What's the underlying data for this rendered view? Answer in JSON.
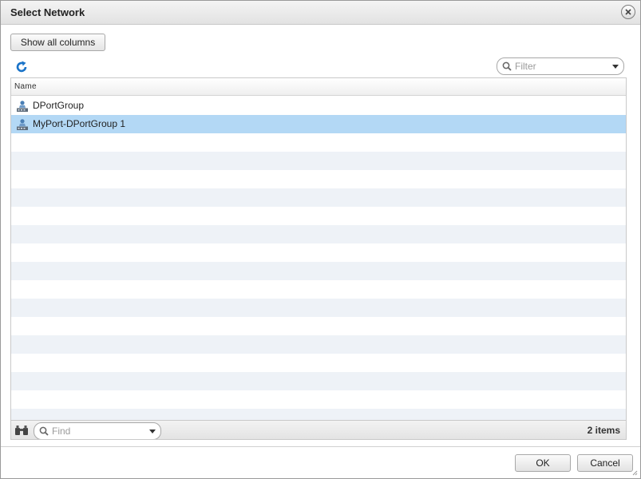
{
  "dialog": {
    "title": "Select Network",
    "close_icon": "close-icon"
  },
  "toolbar": {
    "show_columns_label": "Show all columns",
    "refresh_icon": "refresh-icon",
    "filter_placeholder": "Filter"
  },
  "grid": {
    "columns": [
      "Name"
    ],
    "rows": [
      {
        "name": "DPortGroup",
        "icon": "port-group-icon",
        "selected": false
      },
      {
        "name": "MyPort-DPortGroup 1",
        "icon": "port-group-icon",
        "selected": true
      }
    ],
    "find_placeholder": "Find",
    "item_count": "2 items"
  },
  "buttons": {
    "ok_label": "OK",
    "cancel_label": "Cancel"
  },
  "colors": {
    "selection": "#b3d8f5",
    "stripe": "#eef2f7",
    "accent": "#1a73c8"
  }
}
